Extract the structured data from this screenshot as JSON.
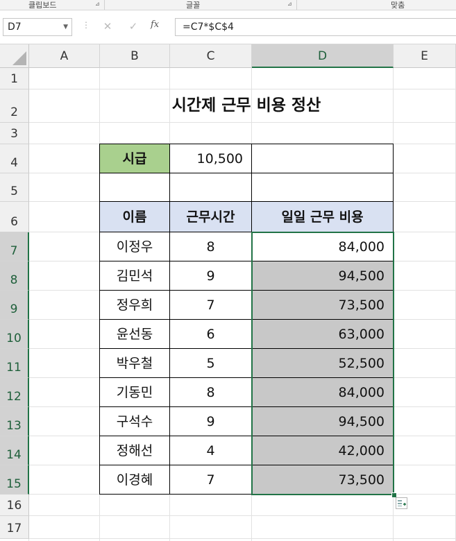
{
  "ribbon": {
    "groups": [
      "클립보드",
      "글꼴",
      "맞춤"
    ],
    "launcher_icon": "dialog-launcher-icon"
  },
  "formula_bar": {
    "name_box": "D7",
    "formula": "=C7*$C$4",
    "icons": [
      "cancel-icon",
      "enter-icon",
      "function-icon"
    ],
    "fx_label": "fx"
  },
  "columns": [
    "A",
    "B",
    "C",
    "D",
    "E"
  ],
  "selected_column": "D",
  "rows": [
    "1",
    "2",
    "3",
    "4",
    "5",
    "6",
    "7",
    "8",
    "9",
    "10",
    "11",
    "12",
    "13",
    "14",
    "15",
    "16",
    "17"
  ],
  "selected_rows": [
    "7",
    "8",
    "9",
    "10",
    "11",
    "12",
    "13",
    "14",
    "15"
  ],
  "sheet": {
    "title": "시간제 근무 비용 정산",
    "wage_label": "시급",
    "wage_value": "10,500",
    "headers": [
      "이름",
      "근무시간",
      "일일 근무 비용"
    ],
    "records": [
      {
        "name": "이정우",
        "hours": "8",
        "cost": "84,000"
      },
      {
        "name": "김민석",
        "hours": "9",
        "cost": "94,500"
      },
      {
        "name": "정우희",
        "hours": "7",
        "cost": "73,500"
      },
      {
        "name": "윤선동",
        "hours": "6",
        "cost": "63,000"
      },
      {
        "name": "박우철",
        "hours": "5",
        "cost": "52,500"
      },
      {
        "name": "기동민",
        "hours": "8",
        "cost": "84,000"
      },
      {
        "name": "구석수",
        "hours": "9",
        "cost": "94,500"
      },
      {
        "name": "정해선",
        "hours": "4",
        "cost": "42,000"
      },
      {
        "name": "이경혜",
        "hours": "7",
        "cost": "73,500"
      }
    ]
  },
  "colors": {
    "accent": "#217346",
    "header_fill": "#d9e1f2",
    "wage_fill": "#a9d08e",
    "selection_fill": "#c8c8c8"
  }
}
